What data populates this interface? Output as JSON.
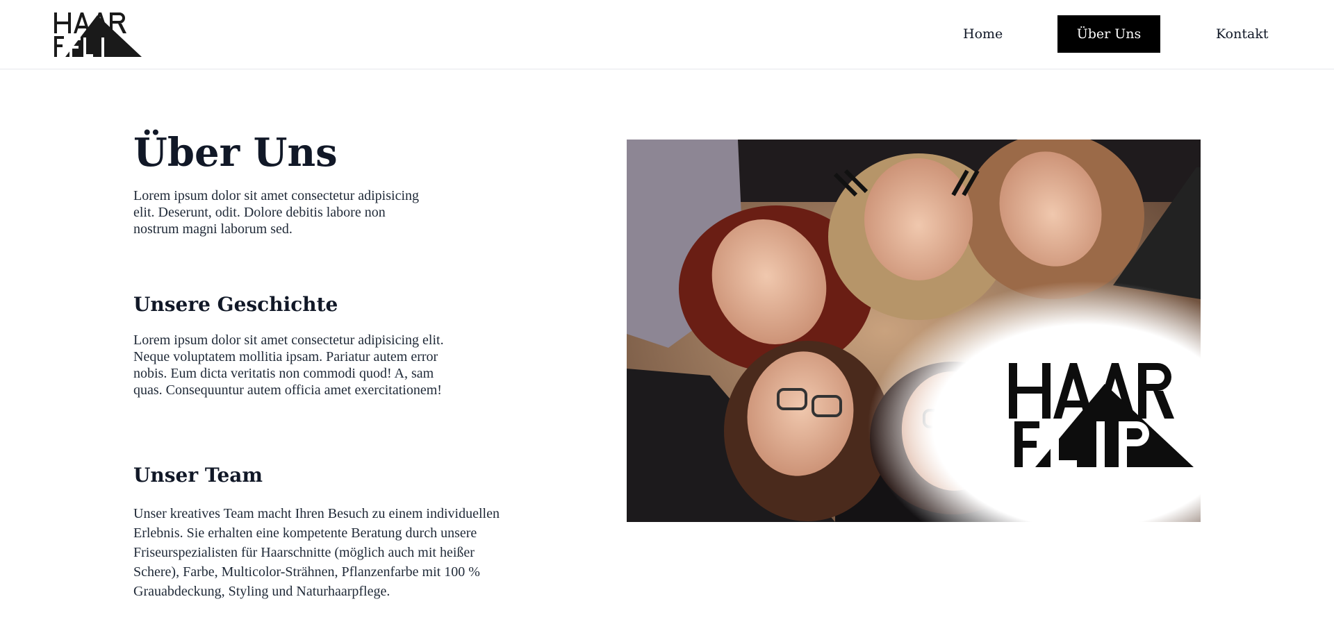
{
  "brand": {
    "logo_alt": "HAAR FLAIR"
  },
  "nav": {
    "items": [
      {
        "label": "Home",
        "active": false
      },
      {
        "label": "Über Uns",
        "active": true
      },
      {
        "label": "Kontakt",
        "active": false
      }
    ]
  },
  "main": {
    "title": "Über Uns",
    "intro": "Lorem ipsum dolor sit amet consectetur adipisicing elit. Deserunt, odit. Dolore debitis labore non nostrum magni laborum sed.",
    "sections": [
      {
        "heading": "Unsere Geschichte",
        "text": "Lorem ipsum dolor sit amet consectetur adipisicing elit. Neque voluptatem mollitia ipsam. Pariatur autem error nobis. Eum dicta veritatis non commodi quod! A, sam quas. Consequuntur autem officia amet exercitationem!"
      },
      {
        "heading": "Unser Team",
        "text": "Unser kreatives Team macht Ihren Besuch zu einem individuellen Erlebnis. Sie erhalten eine kompetente Beratung durch unsere Friseurspezialisten für Haarschnitte (möglich auch mit heißer Schere), Farbe, Multicolor-Strähnen, Pflanzenfarbe mit 100 % Grauabdeckung, Styling und Naturhaarpflege."
      }
    ]
  },
  "hero": {
    "logo_text_top": "HAAR",
    "logo_text_bottom": "FLAIR"
  },
  "colors": {
    "nav_active_bg": "#000000",
    "nav_active_fg": "#ffffff",
    "heading": "#111827",
    "body_text": "#1f2937"
  }
}
